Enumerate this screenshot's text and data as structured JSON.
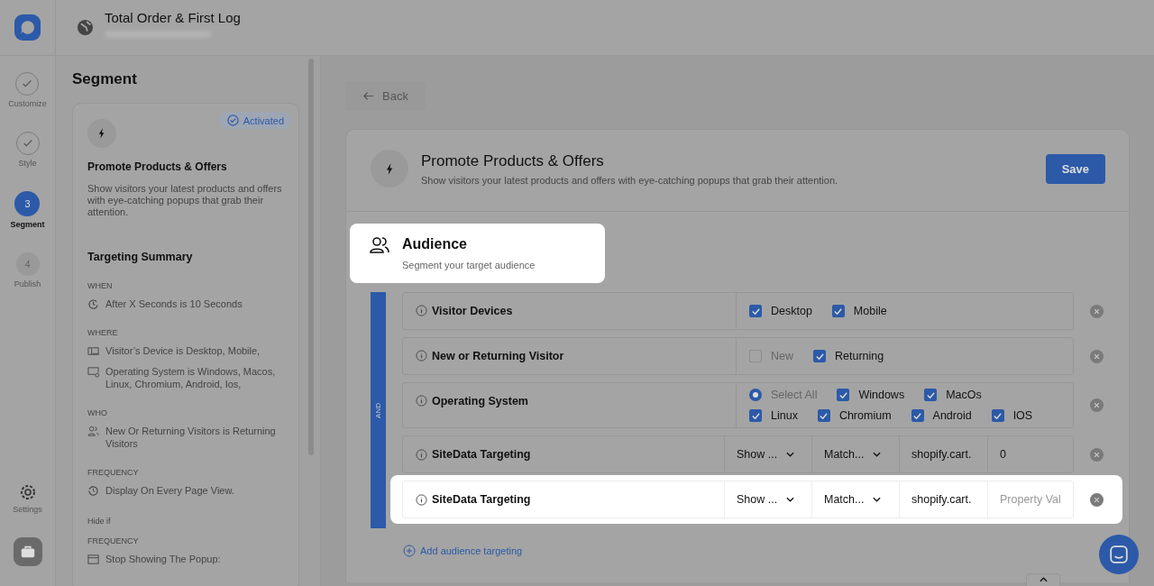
{
  "header": {
    "title": "Total Order & First Log"
  },
  "steps": [
    {
      "label": "Customize",
      "kind": "done"
    },
    {
      "label": "Style",
      "kind": "done"
    },
    {
      "label": "Segment",
      "kind": "current",
      "number": "3"
    },
    {
      "label": "Publish",
      "kind": "pending",
      "number": "4"
    }
  ],
  "settings": {
    "label": "Settings"
  },
  "sidebar": {
    "title": "Segment",
    "campaign": {
      "badge": "Activated",
      "title": "Promote Products & Offers",
      "description": "Show visitors your latest products and offers with eye-catching popups that grab their attention."
    },
    "summary": {
      "title": "Targeting Summary",
      "sections": [
        {
          "kind": "section",
          "heading": "WHEN",
          "items": [
            {
              "kind": "timer",
              "text": "After X Seconds is 10 Seconds"
            }
          ]
        },
        {
          "kind": "section",
          "heading": "WHERE",
          "items": [
            {
              "kind": "device",
              "text": "Visitor’s Device is Desktop, Mobile,"
            },
            {
              "kind": "monitor",
              "text": "Operating System is Windows, Macos, Linux, Chromium, Android, Ios,"
            }
          ]
        },
        {
          "kind": "section",
          "heading": "WHO",
          "items": [
            {
              "kind": "users",
              "text": "New Or Returning Visitors is Returning Visitors"
            }
          ]
        },
        {
          "kind": "section",
          "heading": "FREQUENCY",
          "items": [
            {
              "kind": "history",
              "text": "Display On Every Page View."
            }
          ]
        },
        {
          "kind": "label",
          "heading": "Hide if"
        },
        {
          "kind": "section",
          "heading": "FREQUENCY",
          "items": [
            {
              "kind": "popup",
              "text": "Stop Showing The Popup:"
            }
          ]
        }
      ]
    }
  },
  "main": {
    "back": "Back",
    "campaign": {
      "title": "Promote Products & Offers",
      "description": "Show visitors your latest products and offers with eye-catching popups that grab their attention.",
      "save": "Save"
    },
    "audience": {
      "title": "Audience",
      "subtitle": "Segment your target audience",
      "highlighted": true
    },
    "operator": "AND",
    "rules": [
      {
        "kind": "options",
        "label": "Visitor Devices",
        "highlighted": false,
        "options": [
          {
            "kind": "checkbox",
            "label": "Desktop",
            "checked": true
          },
          {
            "kind": "checkbox",
            "label": "Mobile",
            "checked": true
          }
        ]
      },
      {
        "kind": "options",
        "label": "New or Returning Visitor",
        "highlighted": false,
        "options": [
          {
            "kind": "checkbox",
            "label": "New",
            "checked": false
          },
          {
            "kind": "checkbox",
            "label": "Returning",
            "checked": true
          }
        ]
      },
      {
        "kind": "options",
        "label": "Operating System",
        "highlighted": false,
        "options": [
          {
            "kind": "radio",
            "label": "Select All",
            "checked": true
          },
          {
            "kind": "checkbox",
            "label": "Windows",
            "checked": true
          },
          {
            "kind": "checkbox",
            "label": "MacOs",
            "checked": true
          },
          {
            "kind": "checkbox",
            "label": "Linux",
            "checked": true
          },
          {
            "kind": "checkbox",
            "label": "Chromium",
            "checked": true
          },
          {
            "kind": "checkbox",
            "label": "Android",
            "checked": true
          },
          {
            "kind": "checkbox",
            "label": "IOS",
            "checked": true
          }
        ]
      },
      {
        "kind": "fields",
        "label": "SiteData Targeting",
        "highlighted": false,
        "selects": [
          "Show ...",
          "Match..."
        ],
        "key": "shopify.cart.",
        "value": "0"
      },
      {
        "kind": "fields",
        "label": "SiteData Targeting",
        "highlighted": true,
        "selects": [
          "Show ...",
          "Match..."
        ],
        "key": "shopify.cart.",
        "placeholder": "Property Val"
      }
    ],
    "add": "Add audience targeting"
  }
}
